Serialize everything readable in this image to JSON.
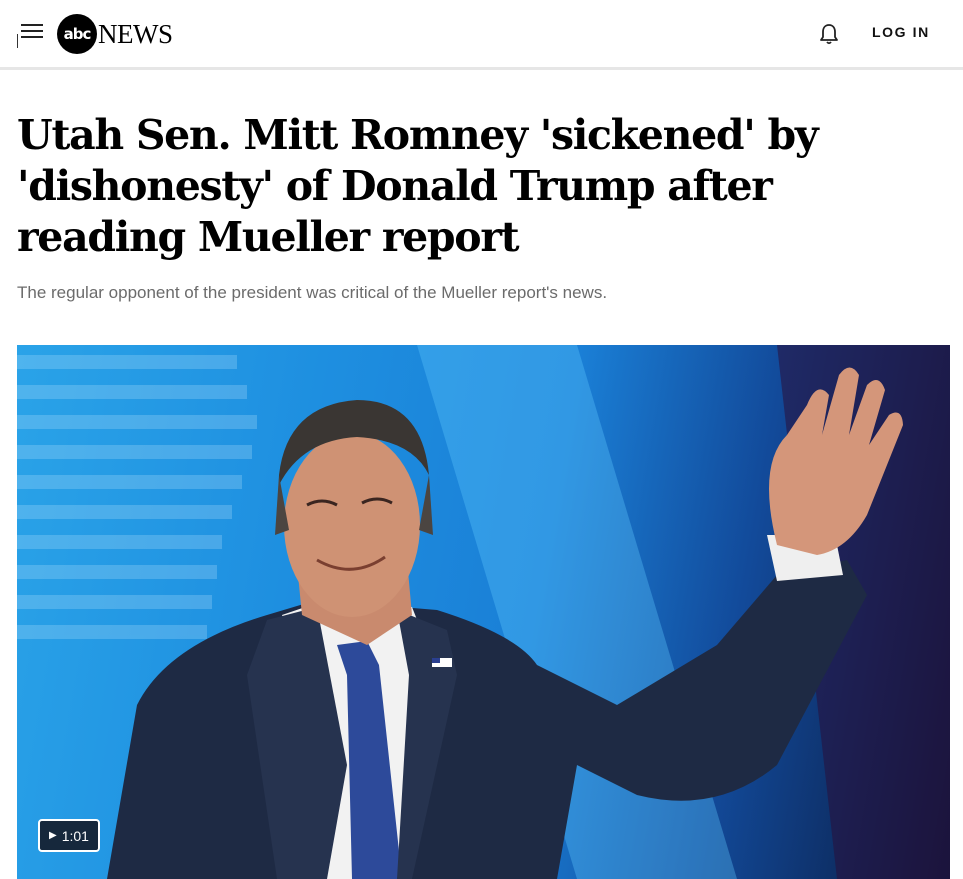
{
  "header": {
    "logo_abc": "abc",
    "logo_news": "NEWS",
    "login_label": "LOG IN",
    "menu_icon": "hamburger-menu-icon",
    "bell_icon": "bell-icon"
  },
  "article": {
    "headline": "Utah Sen. Mitt Romney 'sickened' by 'dishonesty' of Donald Trump after reading Mueller report",
    "subheadline": "The regular opponent of the president was critical of the Mueller report's news."
  },
  "video": {
    "duration": "1:01",
    "play_icon": "play-icon"
  },
  "colors": {
    "background": "#ffffff",
    "subhead_text": "#6b6b6b",
    "header_border": "#e6e6e6"
  }
}
